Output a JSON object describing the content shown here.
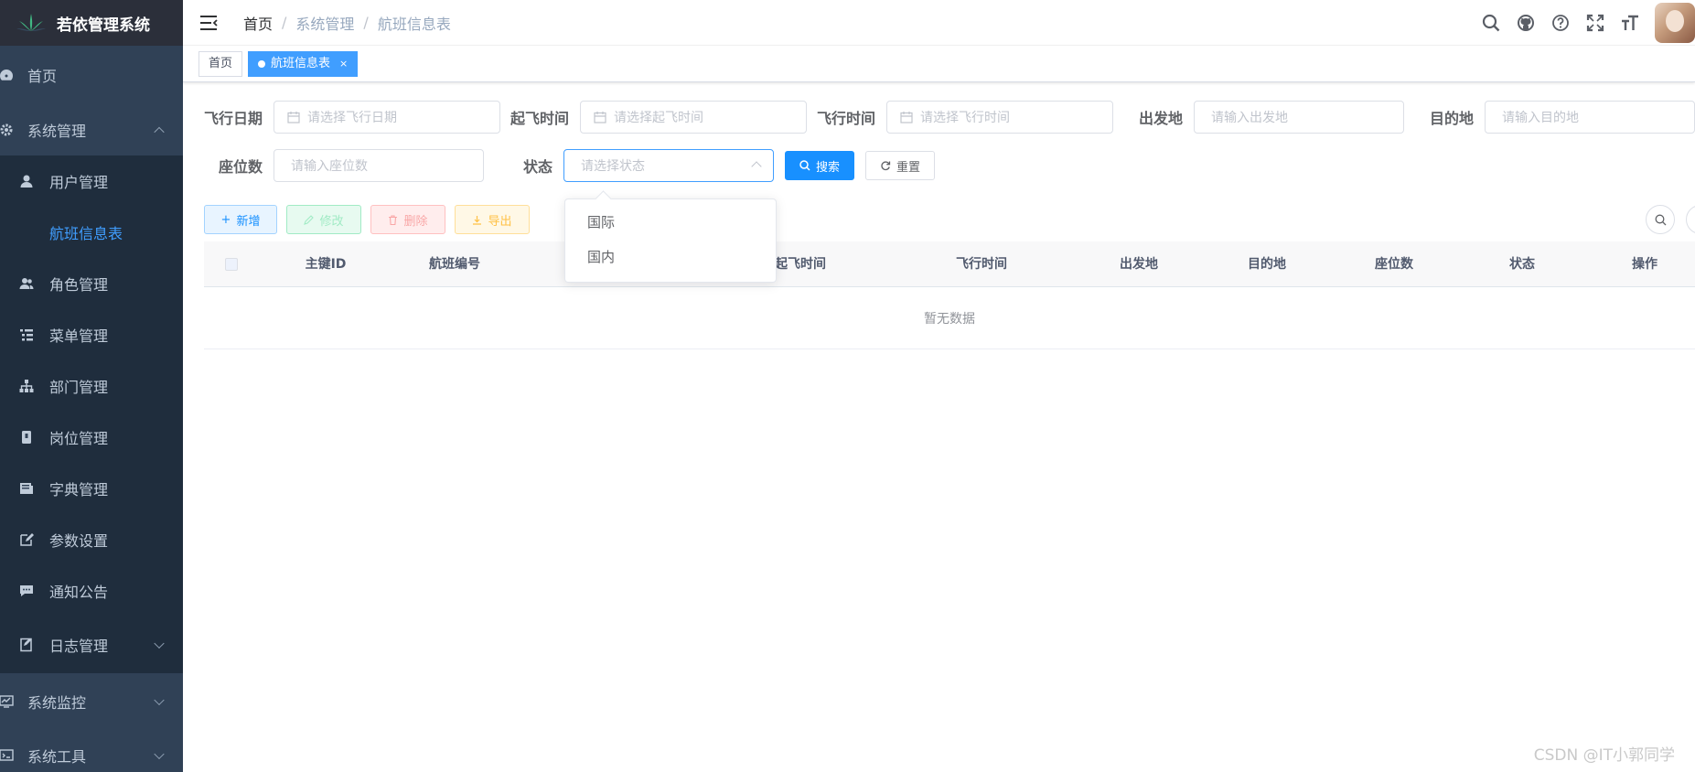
{
  "app": {
    "title": "若依管理系统"
  },
  "sidebar": {
    "items": [
      {
        "label": "首页"
      },
      {
        "label": "系统管理"
      },
      {
        "label": "用户管理"
      },
      {
        "label": "航班信息表"
      },
      {
        "label": "角色管理"
      },
      {
        "label": "菜单管理"
      },
      {
        "label": "部门管理"
      },
      {
        "label": "岗位管理"
      },
      {
        "label": "字典管理"
      },
      {
        "label": "参数设置"
      },
      {
        "label": "通知公告"
      },
      {
        "label": "日志管理"
      },
      {
        "label": "系统监控"
      },
      {
        "label": "系统工具"
      }
    ]
  },
  "breadcrumb": [
    "首页",
    "系统管理",
    "航班信息表"
  ],
  "tags": [
    {
      "label": "首页"
    },
    {
      "label": "航班信息表"
    }
  ],
  "search_form": {
    "flight_date": {
      "label": "飞行日期",
      "placeholder": "请选择飞行日期"
    },
    "takeoff_time": {
      "label": "起飞时间",
      "placeholder": "请选择起飞时间"
    },
    "flight_time": {
      "label": "飞行时间",
      "placeholder": "请选择飞行时间"
    },
    "departure": {
      "label": "出发地",
      "placeholder": "请输入出发地"
    },
    "destination": {
      "label": "目的地",
      "placeholder": "请输入目的地"
    },
    "seats": {
      "label": "座位数",
      "placeholder": "请输入座位数"
    },
    "status": {
      "label": "状态",
      "placeholder": "请选择状态"
    },
    "search_button": "搜索",
    "reset_button": "重置"
  },
  "status_dropdown": {
    "options": [
      "国际",
      "国内"
    ]
  },
  "toolbar": {
    "add": "新增",
    "edit": "修改",
    "delete": "删除",
    "export": "导出"
  },
  "table": {
    "columns": [
      "主键ID",
      "航班编号",
      "起飞时间",
      "飞行时间",
      "出发地",
      "目的地",
      "座位数",
      "状态",
      "操作"
    ],
    "empty_text": "暂无数据"
  },
  "watermark": "CSDN @IT小郭同学",
  "colors": {
    "sidebar_bg": "#304156",
    "primary": "#1890ff",
    "active_menu_text": "#409eff"
  }
}
